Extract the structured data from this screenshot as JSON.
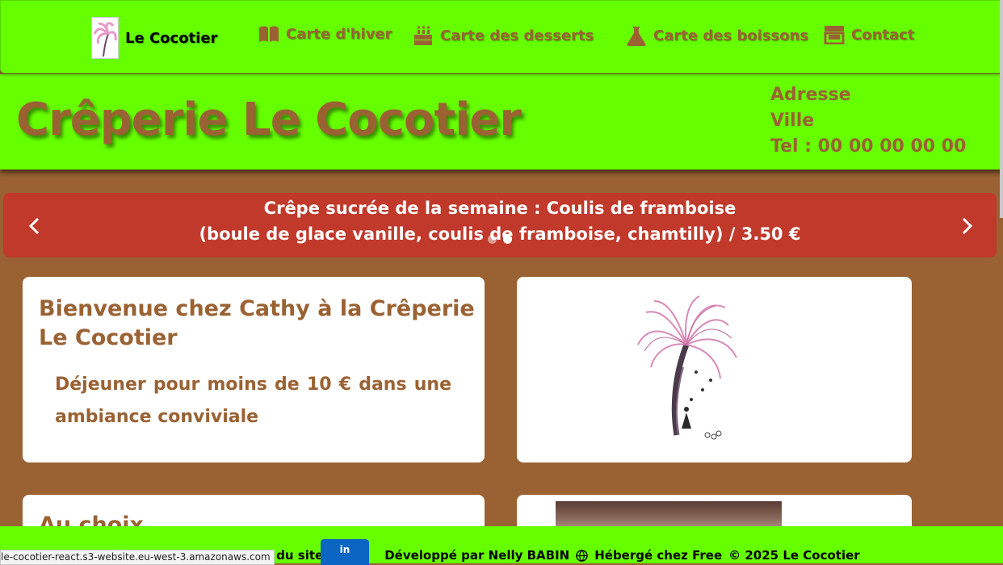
{
  "navbar": {
    "brand": "Le Cocotier",
    "items": [
      {
        "label": "Carte d'hiver",
        "icon": "book-icon"
      },
      {
        "label": "Carte des desserts",
        "icon": "cake-icon"
      },
      {
        "label": "Carte des boissons",
        "icon": "flask-icon"
      },
      {
        "label": "Contact",
        "icon": "store-icon"
      }
    ]
  },
  "header": {
    "title": "Crêperie Le Cocotier",
    "address": "Adresse",
    "city": "Ville",
    "phone": "Tel : 00 00 00 00 00"
  },
  "carousel": {
    "line1": "Crêpe sucrée de la semaine : Coulis de framboise",
    "line2": "(boule de glace vanille, coulis de framboise, chamtilly) / 3.50 €",
    "slide_count": 2,
    "active_index": 1
  },
  "cards": {
    "welcome_title": "Bienvenue chez Cathy à la Crêperie Le Cocotier",
    "welcome_text": "Déjeuner pour moins de 10 € dans une ambiance conviviale",
    "choice_title": "Au choix"
  },
  "footer": {
    "sitemap": "Plan du site",
    "linkedin": "in",
    "developer": "Développé par Nelly BABIN",
    "hosted": "Hébergé chez Free",
    "copyright": "© 2025 Le Cocotier"
  },
  "status_bar": {
    "url": "le-cocotier-react.s3-website.eu-west-3.amazonaws.com"
  },
  "colors": {
    "green": "#66ff00",
    "brown": "#9a6233",
    "red": "#c0392b",
    "linkedin": "#0a66c2"
  }
}
